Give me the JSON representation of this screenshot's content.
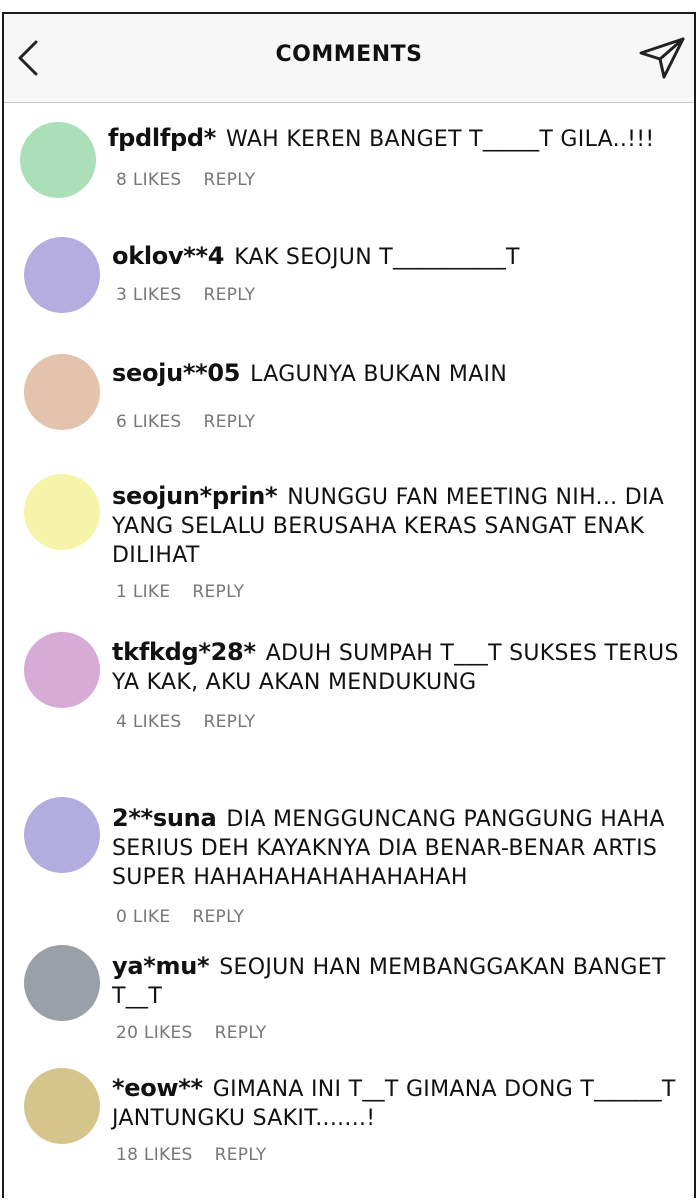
{
  "header": {
    "title": "COMMENTS",
    "back_icon": "chevron-left-icon",
    "send_icon": "send-icon"
  },
  "comments": [
    {
      "username": "fpdlfpd*",
      "text": "WAH KEREN BANGET T_____T GILA..!!!",
      "likes": "8 LIKES",
      "reply": "REPLY",
      "avatar_color": "#aadfb8"
    },
    {
      "username": "oklov**4",
      "text": "KAK SEOJUN T__________T",
      "likes": "3 LIKES",
      "reply": "REPLY",
      "avatar_color": "#b5acdf"
    },
    {
      "username": "seoju**05",
      "text": "LAGUNYA BUKAN MAIN",
      "likes": "6 LIKES",
      "reply": "REPLY",
      "avatar_color": "#e3c3ad"
    },
    {
      "username": "seojun*prin*",
      "text": "NUNGGU FAN MEETING NIH... DIA YANG SELALU BERUSAHA KERAS SANGAT ENAK DILIHAT",
      "likes": "1 LIKE",
      "reply": "REPLY",
      "avatar_color": "#f5f4a8"
    },
    {
      "username": "tkfkdg*28*",
      "text": "ADUH SUMPAH T___T SUKSES TERUS YA KAK, AKU AKAN MENDUKUNG",
      "likes": "4 LIKES",
      "reply": "REPLY",
      "avatar_color": "#d6acd6"
    },
    {
      "username": "2**suna",
      "text": "DIA MENGGUNCANG PANGGUNG HAHA SERIUS DEH KAYAKNYA DIA BENAR-BENAR ARTIS SUPER HAHAHAHAHAHAHAHAH",
      "likes": "0 LIKE",
      "reply": "REPLY",
      "avatar_color": "#b2acdf"
    },
    {
      "username": "ya*mu*",
      "text": "SEOJUN HAN MEMBANGGAKAN BANGET T__T",
      "likes": "20 LIKES",
      "reply": "REPLY",
      "avatar_color": "#9aa0a8"
    },
    {
      "username": "*eow**",
      "text": "GIMANA INI T__T GIMANA DONG T______T JANTUNGKU SAKIT.......!",
      "likes": "18 LIKES",
      "reply": "REPLY",
      "avatar_color": "#d6c58b"
    }
  ]
}
